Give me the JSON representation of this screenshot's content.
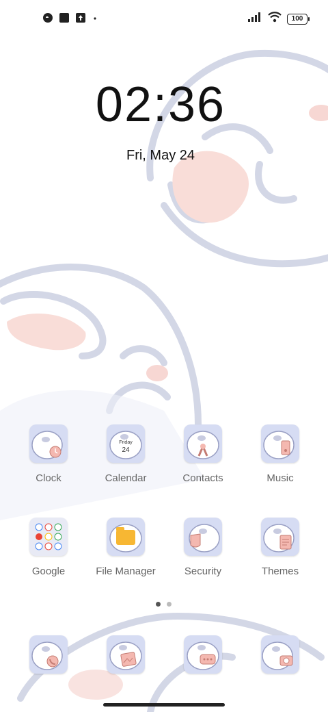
{
  "status_bar": {
    "left_icons": [
      "cat-icon",
      "square-icon",
      "upload-icon",
      "dot-icon"
    ],
    "battery": "100"
  },
  "lock": {
    "time": "02:36",
    "date": "Fri, May 24"
  },
  "apps_row1": [
    {
      "label": "Clock",
      "icon": "clock-icon"
    },
    {
      "label": "Calendar",
      "icon": "calendar-icon",
      "day": "Friday",
      "num": "24"
    },
    {
      "label": "Contacts",
      "icon": "contacts-icon"
    },
    {
      "label": "Music",
      "icon": "music-icon"
    }
  ],
  "apps_row2": [
    {
      "label": "Google",
      "icon": "google-folder-icon"
    },
    {
      "label": "File Manager",
      "icon": "file-manager-icon"
    },
    {
      "label": "Security",
      "icon": "security-icon"
    },
    {
      "label": "Themes",
      "icon": "themes-icon"
    }
  ],
  "dock": [
    {
      "icon": "phone-icon"
    },
    {
      "icon": "gallery-icon"
    },
    {
      "icon": "messages-icon"
    },
    {
      "icon": "camera-icon"
    }
  ],
  "pager": {
    "count": 2,
    "active": 0
  },
  "colors": {
    "accent": "#f4b8b0",
    "mascot_outline": "#c9cde0",
    "icon_bg": "#d6dcf3",
    "folder": "#f7b733"
  }
}
